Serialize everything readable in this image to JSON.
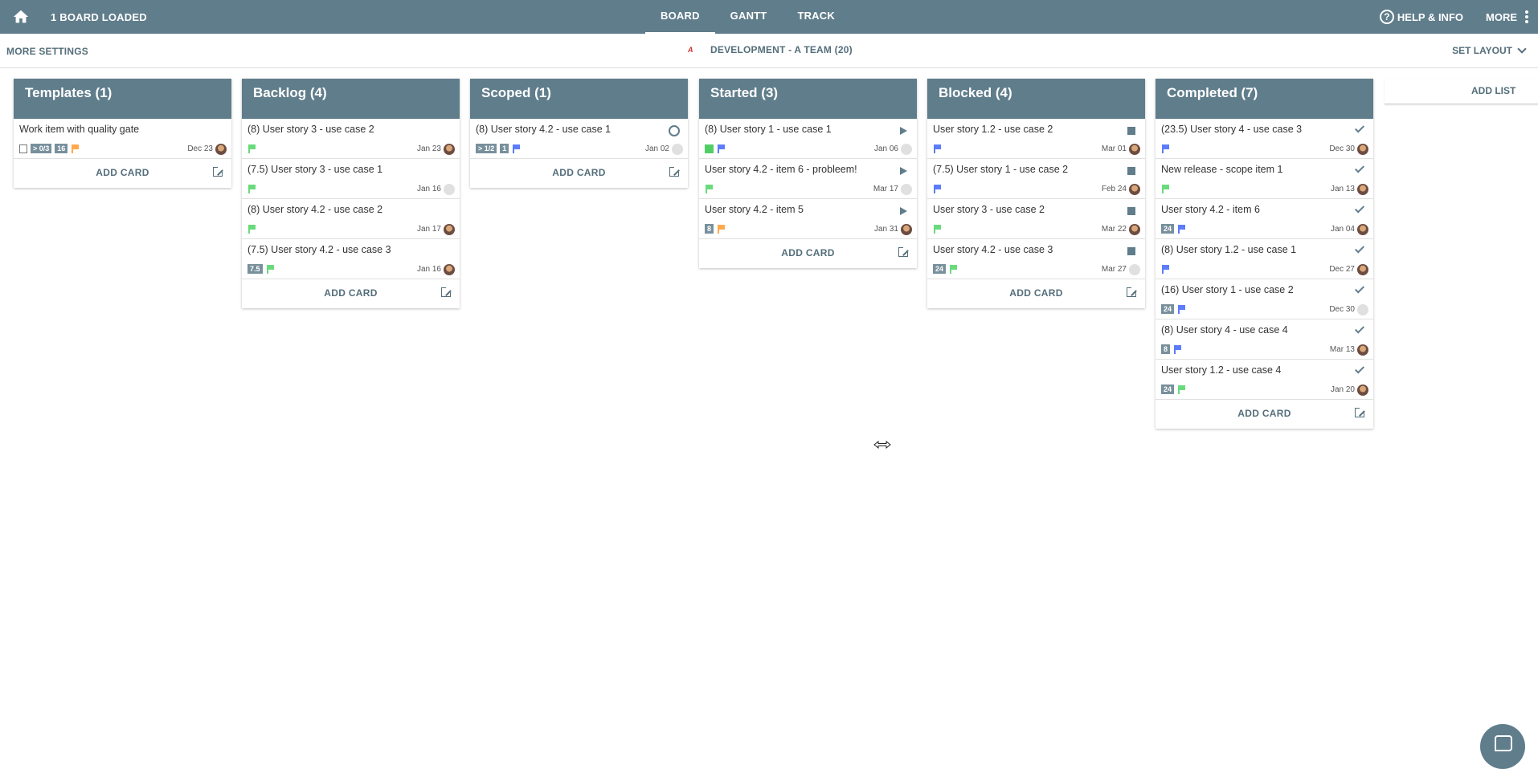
{
  "topbar": {
    "board_count": "1 BOARD LOADED",
    "tabs": [
      {
        "label": "BOARD",
        "active": true
      },
      {
        "label": "GANTT"
      },
      {
        "label": "TRACK"
      }
    ],
    "help": "HELP & INFO",
    "more": "MORE"
  },
  "subbar": {
    "more_settings": "MORE SETTINGS",
    "logo_text": "A",
    "board_title": "DEVELOPMENT - A TEAM (20)",
    "set_layout": "SET LAYOUT"
  },
  "colors": {
    "primary": "#607d8b",
    "flag_green": "#69db7c",
    "flag_blue": "#5c7cfa",
    "flag_orange": "#ffa94d",
    "square_green": "#51cf66"
  },
  "lists": [
    {
      "title": "Templates (1)",
      "add_card": "ADD CARD",
      "cards": [
        {
          "title": "Work item with quality gate",
          "date": "Dec 23",
          "badges": [
            "> 0/3",
            "16"
          ],
          "flag": "orange",
          "copy": true,
          "avatar": "photo"
        }
      ]
    },
    {
      "title": "Backlog (4)",
      "add_card": "ADD CARD",
      "cards": [
        {
          "title": "(8) User story 3 - use case 2",
          "date": "Jan 23",
          "flag": "green",
          "avatar": "photo"
        },
        {
          "title": "(7.5) User story 3 - use case 1",
          "date": "Jan 16",
          "flag": "green",
          "avatar": "placeholder"
        },
        {
          "title": "(8) User story 4.2 - use case 2",
          "date": "Jan 17",
          "flag": "green",
          "avatar": "photo"
        },
        {
          "title": "(7.5) User story 4.2 - use case 3",
          "date": "Jan 16",
          "badges": [
            "7.5"
          ],
          "flag": "green",
          "avatar": "photo"
        }
      ]
    },
    {
      "title": "Scoped (1)",
      "add_card": "ADD CARD",
      "cards": [
        {
          "title": "(8) User story 4.2 - use case 1",
          "date": "Jan 02",
          "badges": [
            "> 1/2",
            "1"
          ],
          "flag": "blue",
          "status": "circle",
          "avatar": "placeholder"
        }
      ]
    },
    {
      "title": "Started (3)",
      "add_card": "ADD CARD",
      "cards": [
        {
          "title": "(8) User story 1 - use case 1",
          "date": "Jan 06",
          "square": "green",
          "flag": "blue",
          "status": "play",
          "avatar": "placeholder"
        },
        {
          "title": "User story 4.2 - item 6 - probleem!",
          "date": "Mar 17",
          "flag": "green",
          "status": "play",
          "avatar": "placeholder"
        },
        {
          "title": "User story 4.2 - item 5",
          "date": "Jan 31",
          "badges": [
            "8"
          ],
          "flag": "orange",
          "status": "play",
          "avatar": "photo"
        }
      ]
    },
    {
      "title": "Blocked (4)",
      "add_card": "ADD CARD",
      "cards": [
        {
          "title": "User story 1.2 - use case 2",
          "date": "Mar 01",
          "flag": "blue",
          "status": "stop",
          "avatar": "photo"
        },
        {
          "title": "(7.5) User story 1 - use case 2",
          "date": "Feb 24",
          "flag": "blue",
          "status": "stop",
          "avatar": "photo"
        },
        {
          "title": "User story 3 - use case 2",
          "date": "Mar 22",
          "flag": "green",
          "status": "stop",
          "avatar": "photo"
        },
        {
          "title": "User story 4.2 - use case 3",
          "date": "Mar 27",
          "badges": [
            "24"
          ],
          "flag": "green",
          "status": "stop",
          "avatar": "placeholder"
        }
      ]
    },
    {
      "title": "Completed (7)",
      "add_card": "ADD CARD",
      "cards": [
        {
          "title": "(23.5) User story 4 - use case 3",
          "date": "Dec 30",
          "flag": "blue",
          "status": "check",
          "avatar": "photo"
        },
        {
          "title": "New release - scope item 1",
          "date": "Jan 13",
          "flag": "green",
          "status": "check",
          "avatar": "photo"
        },
        {
          "title": "User story 4.2 - item 6",
          "date": "Jan 04",
          "badges": [
            "24"
          ],
          "flag": "blue",
          "status": "check",
          "avatar": "photo"
        },
        {
          "title": "(8) User story 1.2 - use case 1",
          "date": "Dec 27",
          "flag": "blue",
          "status": "check",
          "avatar": "photo"
        },
        {
          "title": "(16) User story 1 - use case 2",
          "date": "Dec 30",
          "badges": [
            "24"
          ],
          "flag": "blue",
          "status": "check",
          "avatar": "placeholder"
        },
        {
          "title": "(8) User story 4 - use case 4",
          "date": "Mar 13",
          "badges": [
            "8"
          ],
          "flag": "blue",
          "status": "check",
          "avatar": "photo"
        },
        {
          "title": "User story 1.2 - use case 4",
          "date": "Jan 20",
          "badges": [
            "24"
          ],
          "flag": "green",
          "status": "check",
          "avatar": "photo"
        }
      ]
    }
  ],
  "add_list": "ADD LIST",
  "cursor_icon": "horizontal-resize-icon",
  "chat_icon": "chat-icon"
}
